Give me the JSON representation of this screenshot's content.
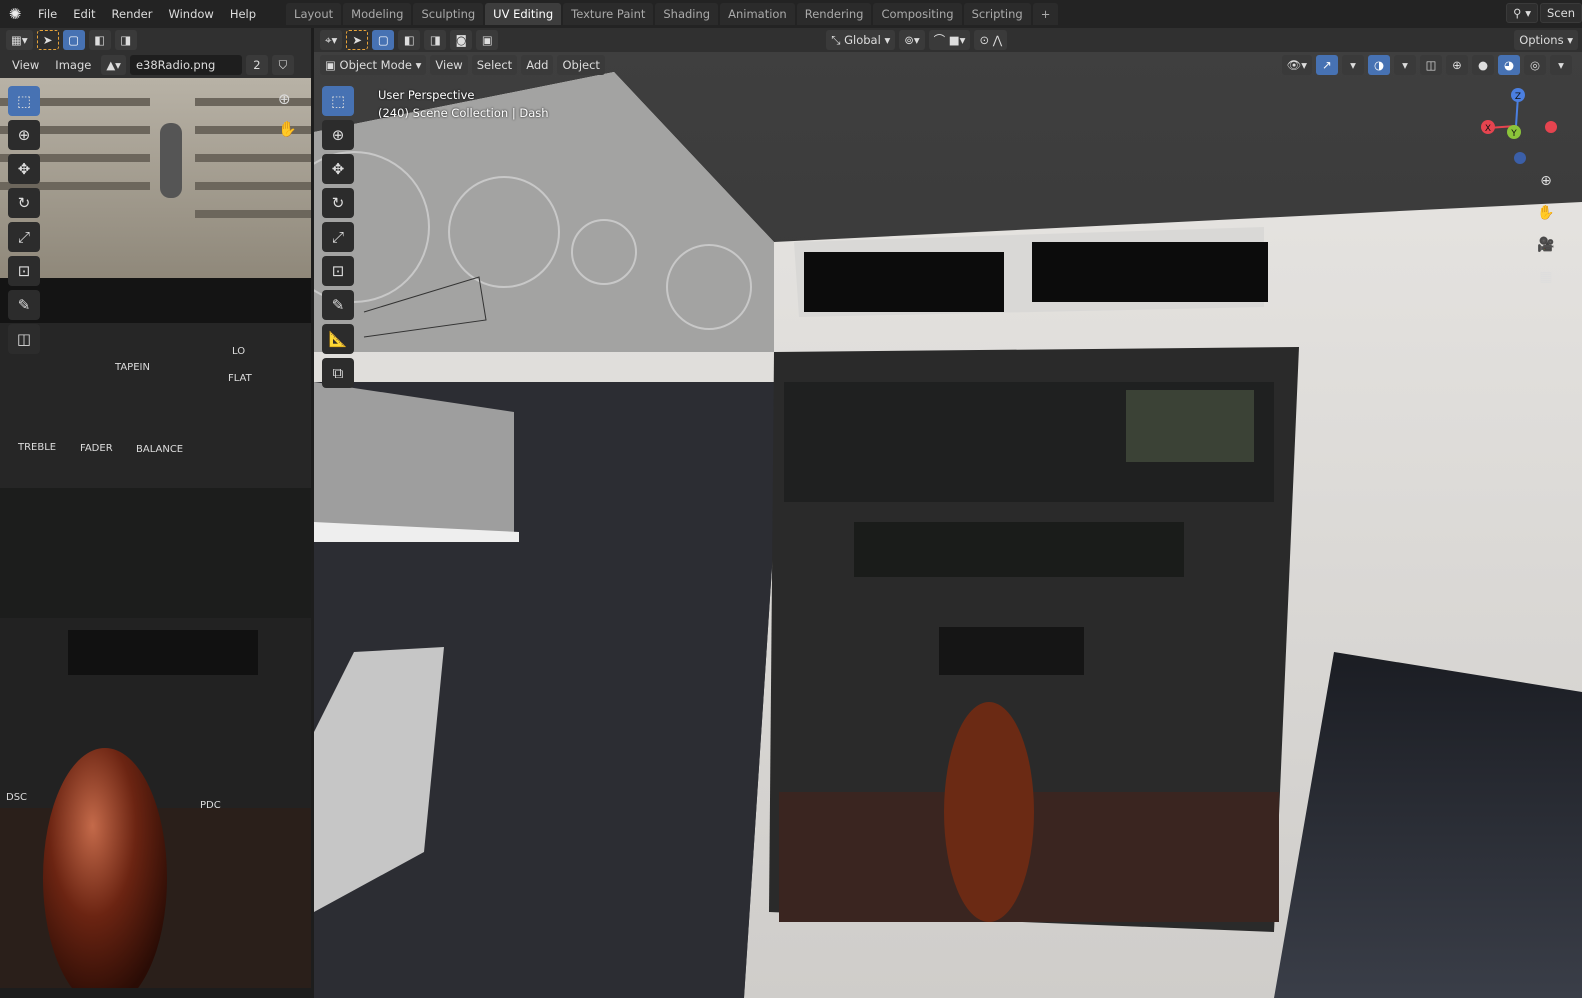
{
  "topbar": {
    "menus": [
      "File",
      "Edit",
      "Render",
      "Window",
      "Help"
    ],
    "workspaces": [
      "Layout",
      "Modeling",
      "Sculpting",
      "UV Editing",
      "Texture Paint",
      "Shading",
      "Animation",
      "Rendering",
      "Compositing",
      "Scripting",
      "+"
    ],
    "active_workspace": "UV Editing",
    "scene_label": "Scen"
  },
  "image_editor": {
    "menus": [
      "View",
      "Image"
    ],
    "image_name": "e38Radio.png",
    "users": "2",
    "texture_labels": [
      "TAPEIN",
      "LO",
      "FLAT",
      "TREBLE",
      "FADER",
      "BALANCE",
      "DSC",
      "PDC"
    ]
  },
  "viewport": {
    "header": {
      "transform_orientation": "Global",
      "options_label": "Options",
      "mode": "Object Mode",
      "menus": [
        "View",
        "Select",
        "Add",
        "Object"
      ]
    },
    "overlay": {
      "perspective": "User Perspective",
      "collection": "(240) Scene Collection | Dash"
    },
    "gizmo": {
      "x": "X",
      "y": "Y",
      "z": "Z"
    },
    "colors": {
      "x_axis": "#e5444f",
      "y_axis": "#8bc43a",
      "z_axis": "#4b7fe0",
      "accent": "#4772b3"
    }
  }
}
